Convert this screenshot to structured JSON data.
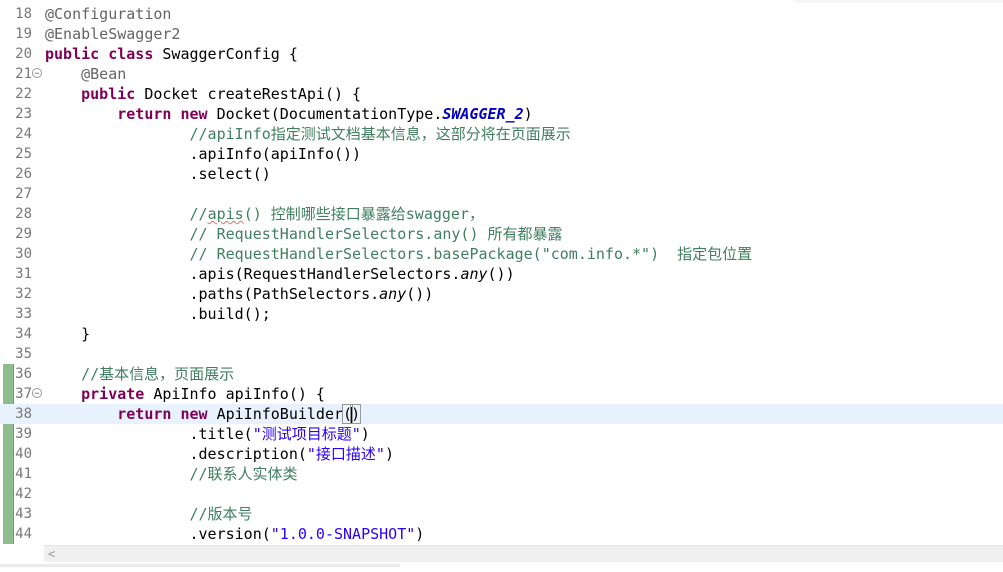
{
  "lines": [
    {
      "num": "18",
      "indent": "",
      "tokens": [
        {
          "t": "@Configuration",
          "c": "ann"
        }
      ]
    },
    {
      "num": "19",
      "indent": "",
      "tokens": [
        {
          "t": "@EnableSwagger2",
          "c": "ann"
        }
      ]
    },
    {
      "num": "20",
      "indent": "",
      "tokens": [
        {
          "t": "public",
          "c": "kw"
        },
        {
          "t": " "
        },
        {
          "t": "class",
          "c": "kw"
        },
        {
          "t": " SwaggerConfig {"
        }
      ]
    },
    {
      "num": "21",
      "fold": true,
      "indent": "    ",
      "tokens": [
        {
          "t": "@Bean",
          "c": "ann"
        }
      ]
    },
    {
      "num": "22",
      "indent": "    ",
      "tokens": [
        {
          "t": "public",
          "c": "kw"
        },
        {
          "t": " Docket createRestApi() {"
        }
      ]
    },
    {
      "num": "23",
      "indent": "        ",
      "tokens": [
        {
          "t": "return",
          "c": "kw"
        },
        {
          "t": " "
        },
        {
          "t": "new",
          "c": "kw"
        },
        {
          "t": " Docket(DocumentationType."
        },
        {
          "t": "SWAGGER_2",
          "c": "static"
        },
        {
          "t": ")"
        }
      ]
    },
    {
      "num": "24",
      "indent": "                ",
      "tokens": [
        {
          "t": "//apiInfo指定测试文档基本信息，这部分将在页面展示",
          "c": "cmt"
        }
      ]
    },
    {
      "num": "25",
      "indent": "                ",
      "tokens": [
        {
          "t": ".apiInfo(apiInfo())"
        }
      ]
    },
    {
      "num": "26",
      "indent": "                ",
      "tokens": [
        {
          "t": ".select()"
        }
      ]
    },
    {
      "num": "27",
      "indent": "",
      "tokens": []
    },
    {
      "num": "28",
      "indent": "                ",
      "tokens": [
        {
          "t": "//",
          "c": "cmt"
        },
        {
          "t": "apis",
          "c": "cmt squig"
        },
        {
          "t": "() 控制哪些接口暴露给swagger，",
          "c": "cmt"
        }
      ]
    },
    {
      "num": "29",
      "indent": "                ",
      "tokens": [
        {
          "t": "// RequestHandlerSelectors.any() 所有都暴露",
          "c": "cmt"
        }
      ]
    },
    {
      "num": "30",
      "indent": "                ",
      "tokens": [
        {
          "t": "// RequestHandlerSelectors.basePackage(\"com.info.*\")  指定包位置",
          "c": "cmt"
        }
      ]
    },
    {
      "num": "31",
      "indent": "                ",
      "tokens": [
        {
          "t": ".apis(RequestHandlerSelectors."
        },
        {
          "t": "any",
          "c": "ital"
        },
        {
          "t": "())"
        }
      ]
    },
    {
      "num": "32",
      "indent": "                ",
      "tokens": [
        {
          "t": ".paths(PathSelectors."
        },
        {
          "t": "any",
          "c": "ital"
        },
        {
          "t": "())"
        }
      ]
    },
    {
      "num": "33",
      "indent": "                ",
      "tokens": [
        {
          "t": ".build();"
        }
      ]
    },
    {
      "num": "34",
      "indent": "    ",
      "tokens": [
        {
          "t": "}"
        }
      ]
    },
    {
      "num": "35",
      "indent": "",
      "tokens": []
    },
    {
      "num": "36",
      "indent": "    ",
      "tokens": [
        {
          "t": "//基本信息，页面展示",
          "c": "cmt"
        }
      ]
    },
    {
      "num": "37",
      "fold": true,
      "indent": "    ",
      "tokens": [
        {
          "t": "private",
          "c": "kw"
        },
        {
          "t": " ApiInfo apiInfo() {"
        }
      ]
    },
    {
      "num": "38",
      "current": true,
      "indent": "        ",
      "tokens": [
        {
          "t": "return",
          "c": "kw"
        },
        {
          "t": " "
        },
        {
          "t": "new",
          "c": "kw"
        },
        {
          "t": " ApiInfoBuilder"
        },
        {
          "t": "(",
          "c": "bracket"
        },
        {
          "t": "",
          "c": "caret"
        },
        {
          "t": ")",
          "c": "bracket"
        }
      ]
    },
    {
      "num": "39",
      "indent": "                ",
      "tokens": [
        {
          "t": ".title("
        },
        {
          "t": "\"测试项目标题\"",
          "c": "str"
        },
        {
          "t": ")"
        }
      ]
    },
    {
      "num": "40",
      "indent": "                ",
      "tokens": [
        {
          "t": ".description("
        },
        {
          "t": "\"接口描述\"",
          "c": "str"
        },
        {
          "t": ")"
        }
      ]
    },
    {
      "num": "41",
      "indent": "                ",
      "tokens": [
        {
          "t": "//联系人实体类",
          "c": "cmt"
        }
      ]
    },
    {
      "num": "42",
      "indent": "",
      "tokens": []
    },
    {
      "num": "43",
      "indent": "                ",
      "tokens": [
        {
          "t": "//版本号",
          "c": "cmt"
        }
      ]
    },
    {
      "num": "44",
      "indent": "                ",
      "tokens": [
        {
          "t": ".version("
        },
        {
          "t": "\"1.0.0-SNAPSHOT\"",
          "c": "str"
        },
        {
          "t": ")"
        }
      ]
    }
  ],
  "scrollbar": {
    "left_arrow": "<"
  },
  "colors": {
    "keyword": "#7f0055",
    "annotation": "#646464",
    "comment": "#3f7f5f",
    "string": "#2a00ff",
    "static_field": "#0000c0",
    "current_line": "#e8f2fe",
    "change_bar": "#8fbc8f"
  }
}
